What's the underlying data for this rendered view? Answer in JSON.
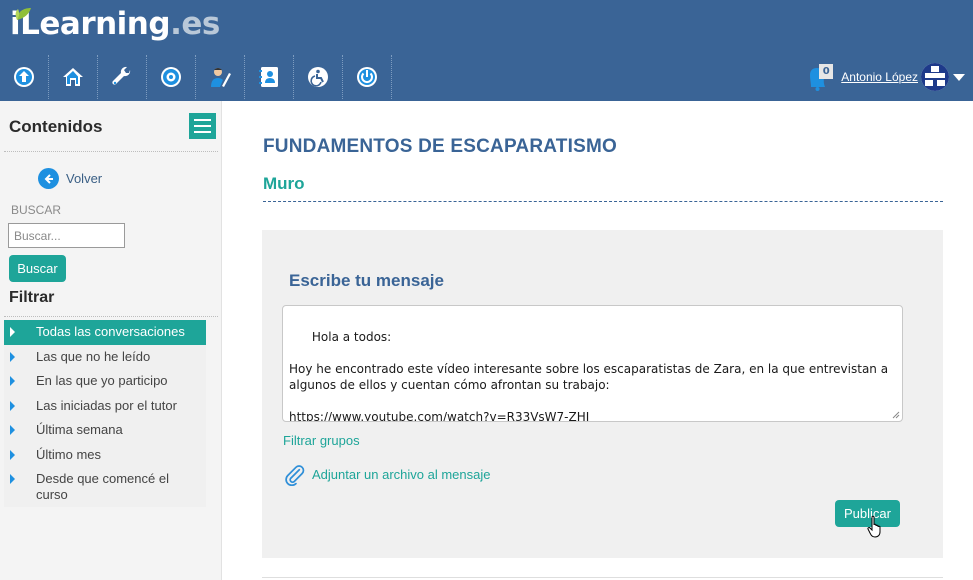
{
  "brand": {
    "logo_main": "iLearning",
    "logo_ext": ".es"
  },
  "toolbar": {
    "icons": [
      "up-arrow-icon",
      "home-icon",
      "wrench-icon",
      "settings-icon",
      "user-edit-icon",
      "contacts-icon",
      "accessibility-icon",
      "power-icon"
    ]
  },
  "user": {
    "notification_count": "0",
    "name": "Antonio López"
  },
  "sidebar": {
    "title": "Contenidos",
    "back_label": "Volver",
    "search_label": "BUSCAR",
    "search_placeholder": "Buscar...",
    "search_button": "Buscar",
    "filter_title": "Filtrar",
    "filters": [
      {
        "label": "Todas las conversaciones",
        "active": true
      },
      {
        "label": "Las que no he leído",
        "active": false
      },
      {
        "label": "En las que yo participo",
        "active": false
      },
      {
        "label": "Las iniciadas por el tutor",
        "active": false
      },
      {
        "label": "Última semana",
        "active": false
      },
      {
        "label": "Último mes",
        "active": false
      },
      {
        "label": "Desde que comencé el curso",
        "active": false
      }
    ]
  },
  "main": {
    "course_title": "FUNDAMENTOS DE ESCAPARATISMO",
    "section_title": "Muro",
    "compose": {
      "title": "Escribe tu mensaje",
      "message": "Hola a todos:\n\nHoy he encontrado este vídeo interesante sobre los escaparatistas de Zara, en la que entrevistan a algunos de ellos y cuentan cómo afrontan su trabajo:\n\nhttps://www.youtube.com/watch?v=R33VsW7-ZHI",
      "groups_link": "Filtrar grupos",
      "attach_label": "Adjuntar un archivo al mensaje",
      "publish_button": "Publicar"
    }
  },
  "colors": {
    "header": "#3a6496",
    "accent": "#1ea599",
    "link_blue": "#1e90e0"
  }
}
